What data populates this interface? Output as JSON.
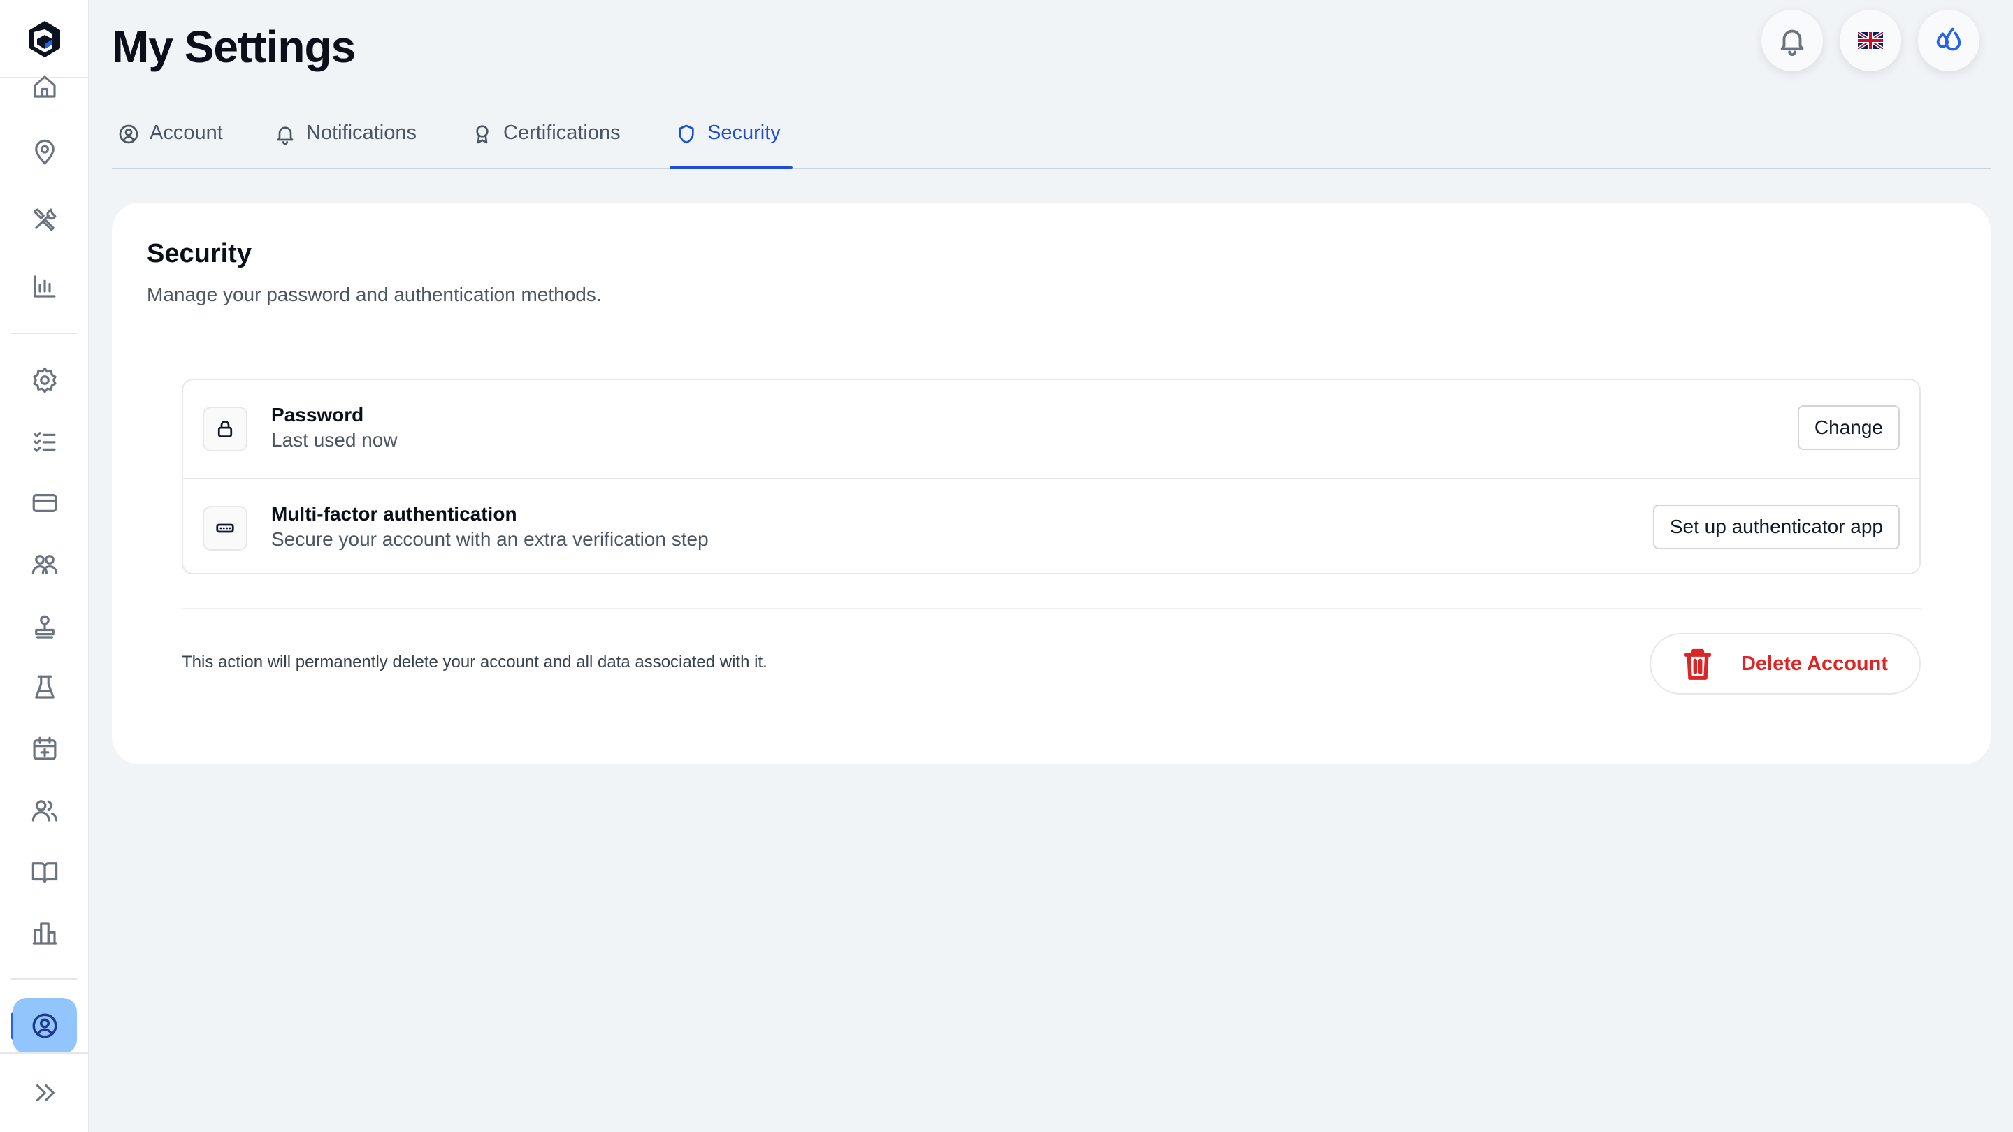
{
  "page": {
    "title": "My Settings"
  },
  "header": {
    "actions": [
      {
        "icon": "bell-icon",
        "label": "Notifications"
      },
      {
        "icon": "uk-flag-icon",
        "label": "Language"
      },
      {
        "icon": "water-drop-icon",
        "label": "Brand"
      }
    ]
  },
  "tabs": [
    {
      "label": "Account",
      "icon": "user-circle-icon",
      "active": false
    },
    {
      "label": "Notifications",
      "icon": "bell-icon",
      "active": false
    },
    {
      "label": "Certifications",
      "icon": "award-icon",
      "active": false
    },
    {
      "label": "Security",
      "icon": "shield-icon",
      "active": true
    }
  ],
  "sidebar": {
    "items": [
      {
        "icon": "home-icon"
      },
      {
        "icon": "map-pin-icon"
      },
      {
        "icon": "tools-icon"
      },
      {
        "icon": "bar-chart-icon"
      },
      {
        "icon": "settings-icon"
      },
      {
        "icon": "checklist-icon"
      },
      {
        "icon": "credit-card-icon"
      },
      {
        "icon": "users-icon"
      },
      {
        "icon": "stamp-icon"
      },
      {
        "icon": "flask-icon"
      },
      {
        "icon": "calendar-plus-icon"
      },
      {
        "icon": "team-icon"
      },
      {
        "icon": "book-open-icon"
      },
      {
        "icon": "building-icon"
      }
    ],
    "active_item": {
      "icon": "user-circle-icon"
    },
    "collapse": {
      "icon": "chevrons-right-icon"
    }
  },
  "security": {
    "title": "Security",
    "subtitle": "Manage your password and authentication methods.",
    "methods": [
      {
        "icon": "lock-icon",
        "title": "Password",
        "description": "Last used now",
        "action": "Change"
      },
      {
        "icon": "keypad-icon",
        "title": "Multi-factor authentication",
        "description": "Secure your account with an extra verification step",
        "action": "Set up authenticator app"
      }
    ],
    "danger": {
      "text": "This action will permanently delete your account and all data associated with it.",
      "button": "Delete Account"
    }
  },
  "colors": {
    "accent": "#1d4ed8",
    "active_nav_bg": "#93c5fd",
    "danger": "#dc2626",
    "background": "#f1f4f7"
  }
}
